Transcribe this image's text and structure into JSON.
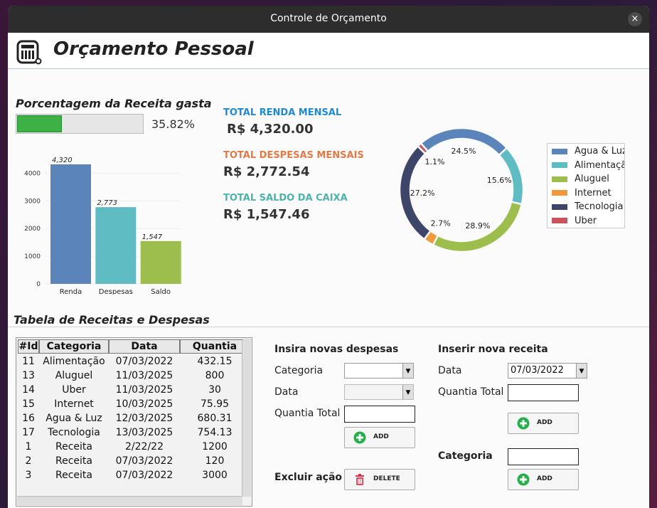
{
  "window": {
    "title": "Controle de Orçamento",
    "close_glyph": "×"
  },
  "header": {
    "title": "Orçamento Pessoal",
    "logo_icon": "calculator-icon"
  },
  "percent_section": {
    "title": "Porcentagem da Receita gasta",
    "percent_text": "35.82%",
    "progress_value": 0.3582
  },
  "totals": {
    "renda_label": "TOTAL RENDA MENSAL",
    "renda_value": "R$ 4,320.00",
    "despesas_label": "TOTAL DESPESAS MENSAIS",
    "despesas_value": "R$ 2,772.54",
    "saldo_label": "TOTAL SALDO DA CAIXA",
    "saldo_value": "R$ 1,547.46",
    "colors": {
      "renda": "#1f8ad0",
      "despesas": "#e07a48",
      "saldo": "#4db3a8"
    }
  },
  "chart_data": [
    {
      "type": "bar",
      "categories": [
        "Renda",
        "Despesas",
        "Saldo"
      ],
      "values": [
        4320,
        2773,
        1547
      ],
      "value_labels": [
        "4,320",
        "2,773",
        "1,547"
      ],
      "ylim": [
        0,
        4500
      ],
      "yticks": [
        0,
        1000,
        2000,
        3000,
        4000
      ],
      "colors": [
        "#5b84bb",
        "#5fbcc2",
        "#9dbe4d"
      ]
    },
    {
      "type": "pie",
      "labels": [
        "Agua & Luz",
        "Alimentação",
        "Aluguel",
        "Internet",
        "Tecnologia",
        "Uber"
      ],
      "legend_labels": [
        "Agua & Luz",
        "Alimentaçã",
        "Aluguel",
        "Internet",
        "Tecnologia",
        "Uber"
      ],
      "values": [
        24.5,
        15.6,
        28.9,
        2.7,
        27.2,
        1.1
      ],
      "value_labels": [
        "24.5%",
        "15.6%",
        "28.9%",
        "2.7%",
        "27.2%",
        "1.1%"
      ],
      "colors": [
        "#5b84bb",
        "#5fbcc2",
        "#9dbe4d",
        "#f0993a",
        "#3d4668",
        "#c9535f"
      ],
      "legend": "right"
    }
  ],
  "table": {
    "title": "Tabela de Receitas e Despesas",
    "columns": [
      "#Id",
      "Categoria",
      "Data",
      "Quantia"
    ],
    "rows": [
      [
        "11",
        "Alimentação",
        "07/03/2022",
        "432.15"
      ],
      [
        "13",
        "Aluguel",
        "11/03/2025",
        "800"
      ],
      [
        "14",
        "Uber",
        "11/03/2025",
        "30"
      ],
      [
        "15",
        "Internet",
        "10/03/2025",
        "75.95"
      ],
      [
        "16",
        "Agua & Luz",
        "12/03/2025",
        "680.31"
      ],
      [
        "17",
        "Tecnologia",
        "13/03/2025",
        "754.13"
      ],
      [
        "1",
        "Receita",
        "2/22/22",
        "1200"
      ],
      [
        "2",
        "Receita",
        "07/03/2022",
        "120"
      ],
      [
        "3",
        "Receita",
        "07/03/2022",
        "3000"
      ]
    ]
  },
  "despesas_form": {
    "title": "Insira novas despesas",
    "categoria_label": "Categoria",
    "data_label": "Data",
    "quantia_label": "Quantia Total",
    "add_label": "ADD"
  },
  "delete_section": {
    "label": "Excluir ação",
    "delete_label": "DELETE"
  },
  "receita_form": {
    "title": "Inserir nova receita",
    "data_label": "Data",
    "data_value": "07/03/2022",
    "quantia_label": "Quantia Total",
    "add_label": "ADD"
  },
  "categoria_form": {
    "label": "Categoria",
    "add_label": "ADD"
  }
}
